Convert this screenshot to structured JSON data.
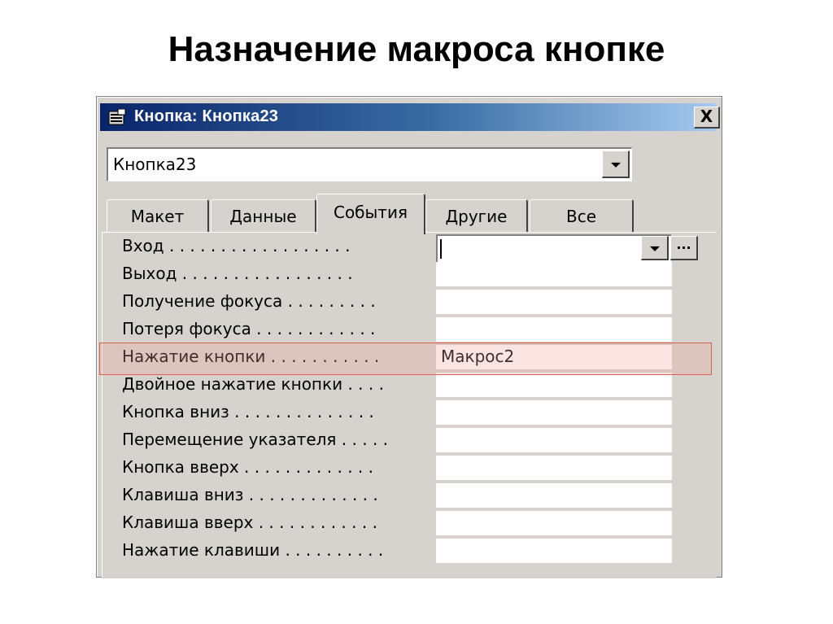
{
  "slide": {
    "title": "Назначение макроса кнопке"
  },
  "window": {
    "title": "Кнопка: Кнопка23",
    "close_label": "X",
    "object_selector": {
      "value": "Кнопка23"
    }
  },
  "tabs": [
    {
      "label": "Макет",
      "active": false
    },
    {
      "label": "Данные",
      "active": false
    },
    {
      "label": "События",
      "active": true
    },
    {
      "label": "Другие",
      "active": false
    },
    {
      "label": "Все",
      "active": false
    }
  ],
  "properties": [
    {
      "label": "Вход . . . . . . . . . . . . . . . . . .",
      "value": ""
    },
    {
      "label": "Выход . . . . . . . . . . . . . . . . .",
      "value": ""
    },
    {
      "label": "Получение фокуса . . . . . . . . .",
      "value": ""
    },
    {
      "label": "Потеря фокуса . . . . . . . . . . . .",
      "value": ""
    },
    {
      "label": "Нажатие кнопки . . . . . . . . . . .",
      "value": "Макрос2"
    },
    {
      "label": "Двойное нажатие кнопки . . . .",
      "value": ""
    },
    {
      "label": "Кнопка вниз . . . . . . . . . . . . . .",
      "value": ""
    },
    {
      "label": "Перемещение указателя . . . . .",
      "value": ""
    },
    {
      "label": "Кнопка вверх . . . . . . . . . . . . .",
      "value": ""
    },
    {
      "label": "Клавиша вниз . . . . . . . . . . . . .",
      "value": ""
    },
    {
      "label": "Клавиша вверх . . . . . . . . . . . .",
      "value": ""
    },
    {
      "label": "Нажатие клавиши . . . . . . . . . .",
      "value": ""
    }
  ],
  "builder_button_label": "...",
  "colors": {
    "highlight_border": "#d95f4b",
    "titlebar_start": "#0a246a",
    "titlebar_end": "#a6caf0"
  },
  "icons": {
    "app": "properties-icon",
    "dropdown": "chevron-down-icon",
    "builder": "ellipsis-icon"
  }
}
